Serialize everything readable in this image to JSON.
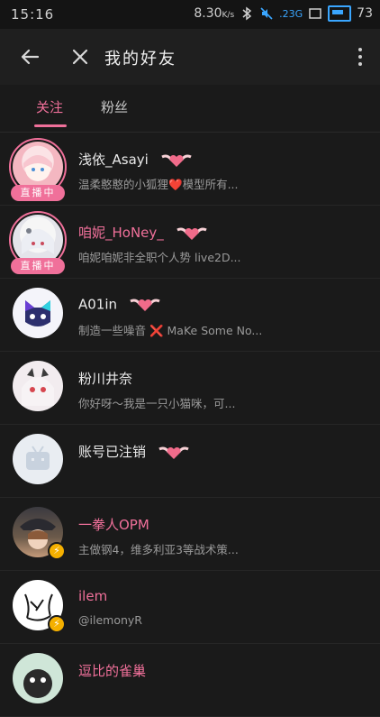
{
  "status_bar": {
    "time": "15:16",
    "speed": "8.30",
    "speed_unit": "K/s",
    "signal": ".23G",
    "battery": "73"
  },
  "toolbar": {
    "title": "我的好友"
  },
  "tabs": [
    {
      "label": "关注",
      "active": true
    },
    {
      "label": "粉丝",
      "active": false
    }
  ],
  "colors": {
    "accent": "#f0709a",
    "background": "#1a1a1a"
  },
  "users": [
    {
      "name": "浅依_Asayi",
      "desc": "温柔憨憨的小狐狸❤️模型所有...",
      "badge": "直播中",
      "name_pink": false
    },
    {
      "name": "咱妮_HoNey_",
      "desc": "咱妮咱妮非全职个人势 live2D...",
      "badge": "直播中",
      "name_pink": true
    },
    {
      "name": "A01in",
      "desc": "制造一些噪音 ❌ MaKe Some No...",
      "badge": "",
      "name_pink": false
    },
    {
      "name": "粉川井奈",
      "desc": "你好呀～我是一只小猫咪，可...",
      "badge": "",
      "name_pink": false
    },
    {
      "name": "账号已注销",
      "desc": "",
      "badge": "",
      "name_pink": false
    },
    {
      "name": "一拳人OPM",
      "desc": "主做钢4，维多利亚3等战术策...",
      "badge": "",
      "name_pink": true
    },
    {
      "name": "ilem",
      "desc": "@ilemonyR",
      "badge": "",
      "name_pink": true
    },
    {
      "name": "逗比的雀巢",
      "desc": "",
      "badge": "",
      "name_pink": true
    }
  ]
}
